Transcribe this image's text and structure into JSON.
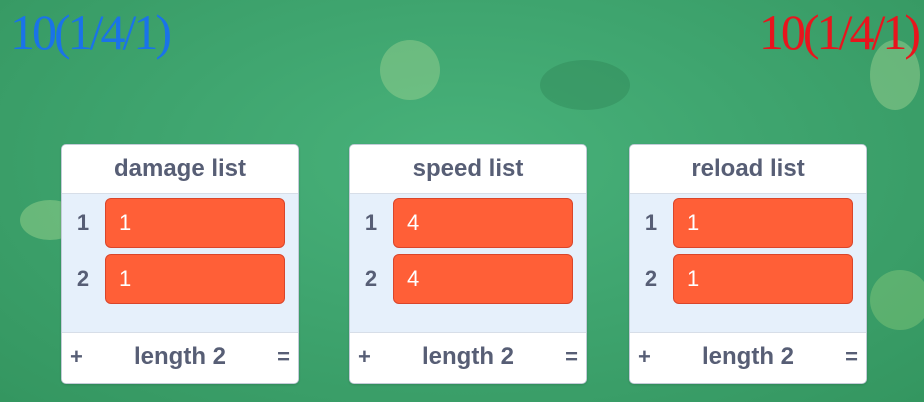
{
  "scores": {
    "left": {
      "text": "10(1/4/1)",
      "color": "#1a73e8"
    },
    "right": {
      "text": "10(1/4/1)",
      "color": "#e8151d"
    }
  },
  "lists": [
    {
      "title": "damage list",
      "items": [
        "1",
        "1"
      ],
      "indices": [
        "1",
        "2"
      ],
      "add": "+",
      "length": "length 2",
      "resize": "="
    },
    {
      "title": "speed list",
      "items": [
        "4",
        "4"
      ],
      "indices": [
        "1",
        "2"
      ],
      "add": "+",
      "length": "length 2",
      "resize": "="
    },
    {
      "title": "reload list",
      "items": [
        "1",
        "1"
      ],
      "indices": [
        "1",
        "2"
      ],
      "add": "+",
      "length": "length 2",
      "resize": "="
    }
  ],
  "colors": {
    "list_item": "#ff5f37",
    "list_body": "#e6f0fb",
    "label": "#575e75",
    "stage_bg": "#3fa56f"
  }
}
